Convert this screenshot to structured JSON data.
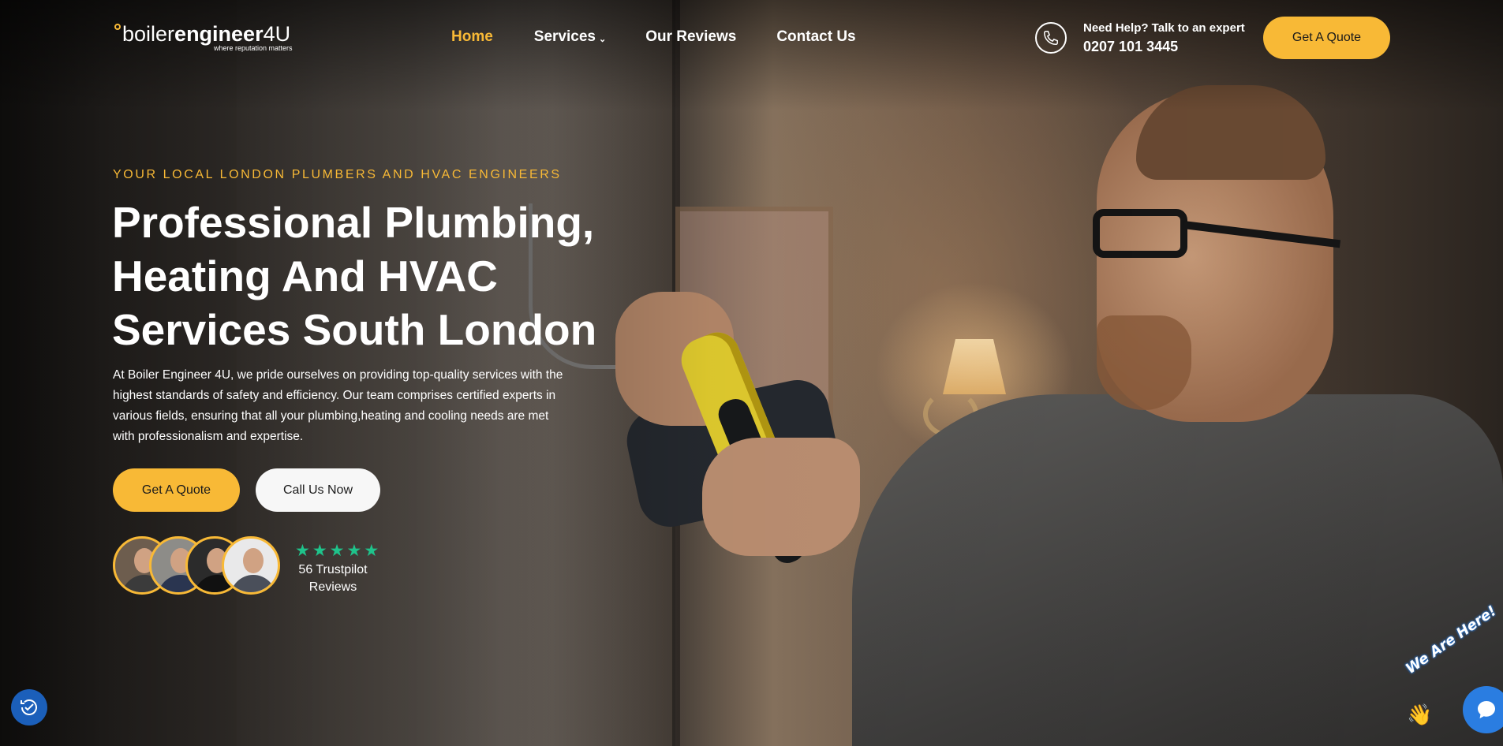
{
  "header": {
    "logo": {
      "word_regular": "boiler",
      "word_bold": "engineer",
      "suffix": "4U",
      "tagline": "where reputation matters"
    },
    "nav": [
      {
        "label": "Home",
        "active": true
      },
      {
        "label": "Services",
        "has_dropdown": true
      },
      {
        "label": "Our Reviews"
      },
      {
        "label": "Contact Us"
      }
    ],
    "contact": {
      "icon": "phone-icon",
      "help_text": "Need Help? Talk to an expert",
      "phone": "0207 101 3445"
    },
    "quote_button": "Get A Quote"
  },
  "hero": {
    "eyebrow": "YOUR LOCAL LONDON PLUMBERS AND HVAC ENGINEERS",
    "headline_lines": [
      "Professional Plumbing,",
      "Heating And HVAC",
      "Services South London"
    ],
    "intro": "At Boiler Engineer 4U, we pride ourselves on providing top-quality services with the highest standards of safety and efficiency. Our team comprises certified experts in various fields, ensuring that all your plumbing,heating and cooling needs are met with professionalism and expertise.",
    "primary_button": "Get A Quote",
    "secondary_button": "Call Us Now",
    "rating": {
      "stars": 5,
      "text": "56 Trustpilot Reviews"
    }
  },
  "widgets": {
    "chat_badge": "We Are Here!",
    "accessibility_icon": "accessibility-icon",
    "chat_icon": "chat-icon"
  },
  "colors": {
    "accent": "#f8b936",
    "trustpilot_green": "#1fc38b",
    "chat_blue": "#2a7de1",
    "accessibility_blue": "#1b5fba"
  }
}
